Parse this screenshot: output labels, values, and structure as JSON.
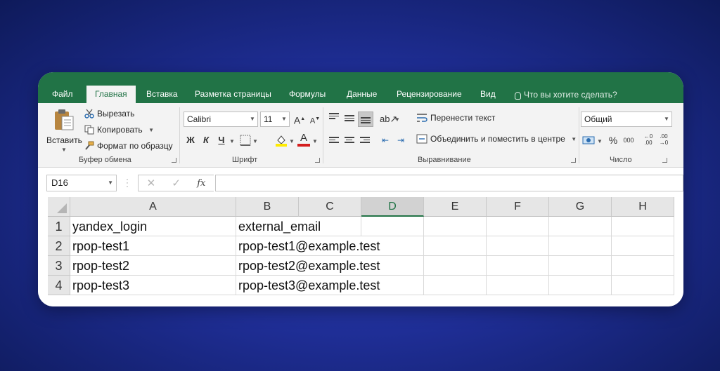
{
  "tabs": {
    "file": "Файл",
    "home": "Главная",
    "insert": "Вставка",
    "page_layout": "Разметка страницы",
    "formulas": "Формулы",
    "data": "Данные",
    "review": "Рецензирование",
    "view": "Вид",
    "tell_me": "Что вы хотите сделать?"
  },
  "ribbon": {
    "clipboard": {
      "label": "Буфер обмена",
      "paste": "Вставить",
      "cut": "Вырезать",
      "copy": "Копировать",
      "format_painter": "Формат по образцу"
    },
    "font": {
      "label": "Шрифт",
      "name": "Calibri",
      "size": "11",
      "bold": "Ж",
      "italic": "К",
      "underline": "Ч",
      "fill_color": "#ffeb00",
      "font_color": "#d41e1e"
    },
    "alignment": {
      "label": "Выравнивание",
      "wrap_text": "Перенести текст",
      "merge_center": "Объединить и поместить в центре"
    },
    "number": {
      "label": "Число",
      "format": "Общий",
      "percent": "%",
      "thousands": "000"
    }
  },
  "formula_bar": {
    "name_box": "D16",
    "fx": "fx",
    "value": ""
  },
  "sheet": {
    "columns": [
      "A",
      "B",
      "C",
      "D",
      "E",
      "F",
      "G",
      "H"
    ],
    "selected_column": "D",
    "rows": [
      {
        "num": "1",
        "a": "yandex_login",
        "b": "external_email"
      },
      {
        "num": "2",
        "a": "rpop-test1",
        "b": "rpop-test1@example.test"
      },
      {
        "num": "3",
        "a": "rpop-test2",
        "b": "rpop-test2@example.test"
      },
      {
        "num": "4",
        "a": "rpop-test3",
        "b": "rpop-test3@example.test"
      }
    ]
  },
  "colors": {
    "accent": "#217346"
  }
}
